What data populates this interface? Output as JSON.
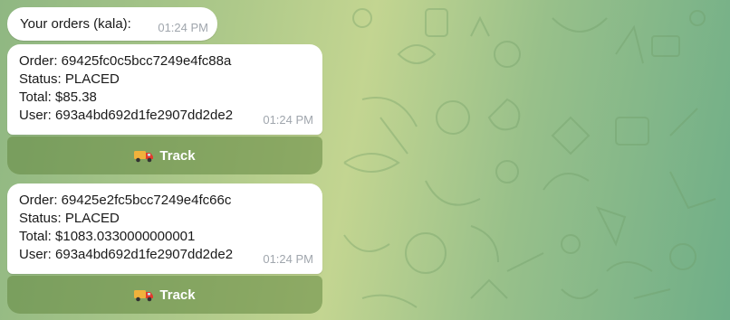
{
  "chat": {
    "header_message": {
      "text": "Your orders (kala):",
      "time": "01:24 PM"
    },
    "orders": [
      {
        "lines": [
          "Order: 69425fc0c5bcc7249e4fc88a",
          "Status: PLACED",
          "Total: $85.38",
          "User: 693a4bd692d1fe2907dd2de2"
        ],
        "time": "01:24 PM",
        "button_label": "Track",
        "button_icon": "delivery-truck-icon"
      },
      {
        "lines": [
          "Order: 69425e2fc5bcc7249e4fc66c",
          "Status: PLACED",
          "Total: $1083.0330000000001",
          "User: 693a4bd692d1fe2907dd2de2"
        ],
        "time": "01:24 PM",
        "button_label": "Track",
        "button_icon": "delivery-truck-icon"
      }
    ]
  },
  "colors": {
    "bubble": "#ffffff",
    "button_overlay": "#628640",
    "timestamp": "#a0a6ad",
    "wallpaper_left": "#8fb782",
    "wallpaper_right": "#6fae88"
  }
}
